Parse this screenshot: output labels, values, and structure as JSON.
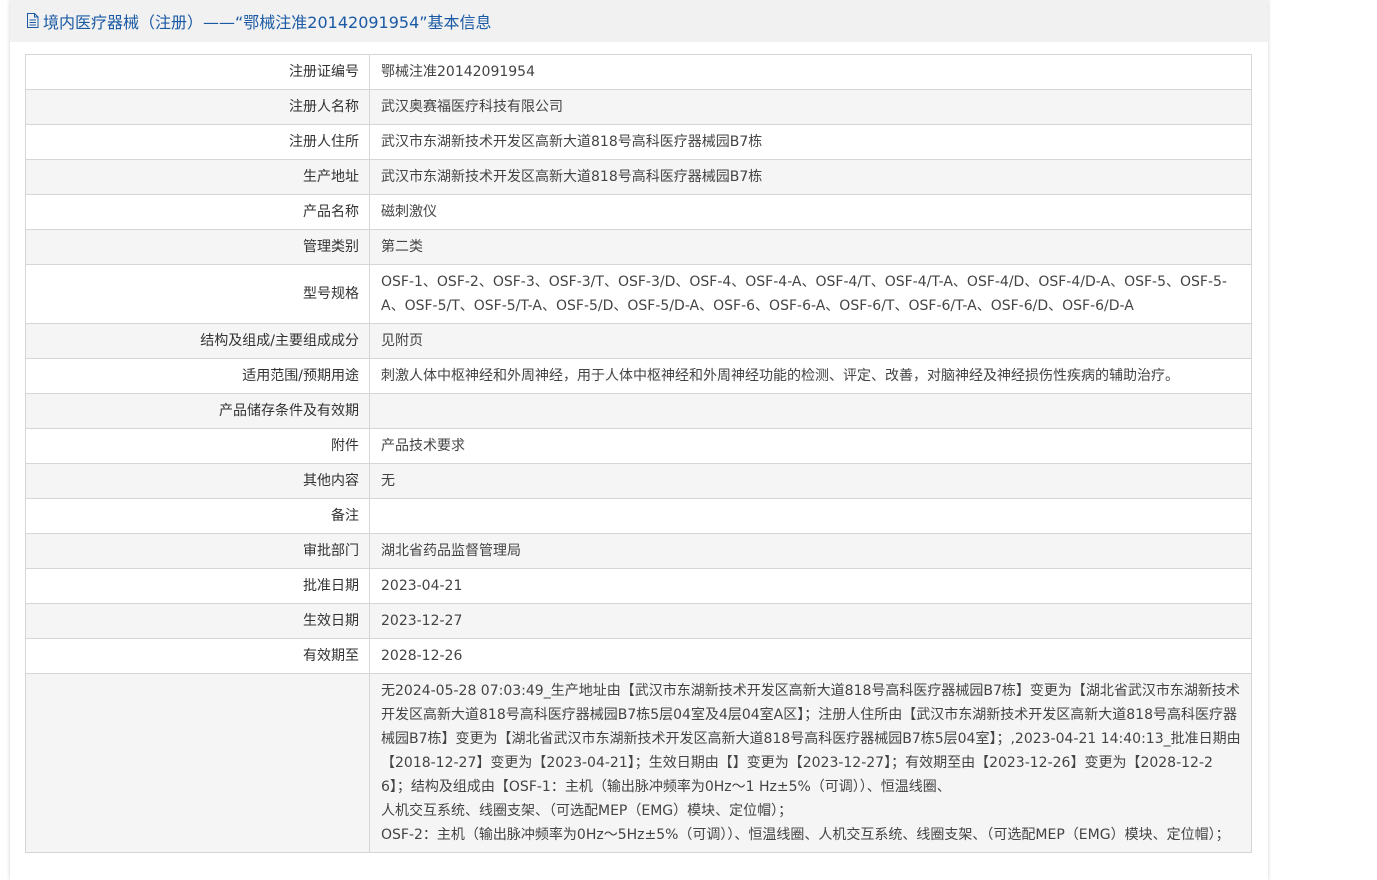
{
  "header": {
    "title": "境内医疗器械（注册）——“鄂械注准20142091954”基本信息"
  },
  "rows": [
    {
      "label": "注册证编号",
      "value": "鄂械注准20142091954"
    },
    {
      "label": "注册人名称",
      "value": "武汉奥赛福医疗科技有限公司"
    },
    {
      "label": "注册人住所",
      "value": "武汉市东湖新技术开发区高新大道818号高科医疗器械园B7栋"
    },
    {
      "label": "生产地址",
      "value": "武汉市东湖新技术开发区高新大道818号高科医疗器械园B7栋"
    },
    {
      "label": "产品名称",
      "value": "磁刺激仪"
    },
    {
      "label": "管理类别",
      "value": "第二类"
    },
    {
      "label": "型号规格",
      "value": "OSF-1、OSF-2、OSF-3、OSF-3/T、OSF-3/D、OSF-4、OSF-4-A、OSF-4/T、OSF-4/T-A、OSF-4/D、OSF-4/D-A、OSF-5、OSF-5-A、OSF-5/T、OSF-5/T-A、OSF-5/D、OSF-5/D-A、OSF-6、OSF-6-A、OSF-6/T、OSF-6/T-A、OSF-6/D、OSF-6/D-A"
    },
    {
      "label": "结构及组成/主要组成成分",
      "value": "见附页"
    },
    {
      "label": "适用范围/预期用途",
      "value": "刺激人体中枢神经和外周神经，用于人体中枢神经和外周神经功能的检测、评定、改善，对脑神经及神经损伤性疾病的辅助治疗。"
    },
    {
      "label": "产品储存条件及有效期",
      "value": ""
    },
    {
      "label": "附件",
      "value": "产品技术要求"
    },
    {
      "label": "其他内容",
      "value": "无"
    },
    {
      "label": "备注",
      "value": ""
    },
    {
      "label": "审批部门",
      "value": "湖北省药品监督管理局"
    },
    {
      "label": "批准日期",
      "value": "2023-04-21"
    },
    {
      "label": "生效日期",
      "value": "2023-12-27"
    },
    {
      "label": "有效期至",
      "value": "2028-12-26"
    }
  ],
  "change_history": {
    "label": "",
    "lines": [
      "无2024-05-28 07:03:49_生产地址由【武汉市东湖新技术开发区高新大道818号高科医疗器械园B7栋】变更为【湖北省武汉市东湖新技术开发区高新大道818号高科医疗器械园B7栋5层04室及4层04室A区】；注册人住所由【武汉市东湖新技术开发区高新大道818号高科医疗器械园B7栋】变更为【湖北省武汉市东湖新技术开发区高新大道818号高科医疗器械园B7栋5层04室】；,2023-04-21 14:40:13_批准日期由【2018-12-27】变更为【2023-04-21】；生效日期由【】变更为【2023-12-27】；有效期至由【2023-12-26】变更为【2028-12-26】；结构及组成由【OSF-1：主机（输出脉冲频率为0Hz～1 Hz±5%（可调））、恒温线圈、",
      "人机交互系统、线圈支架、（可选配MEP（EMG）模块、定位帽）；",
      "OSF-2：主机（输出脉冲频率为0Hz～5Hz±5%（可调））、恒温线圈、人机交互系统、线圈支架、（可选配MEP（EMG）模块、定位帽）；"
    ]
  }
}
